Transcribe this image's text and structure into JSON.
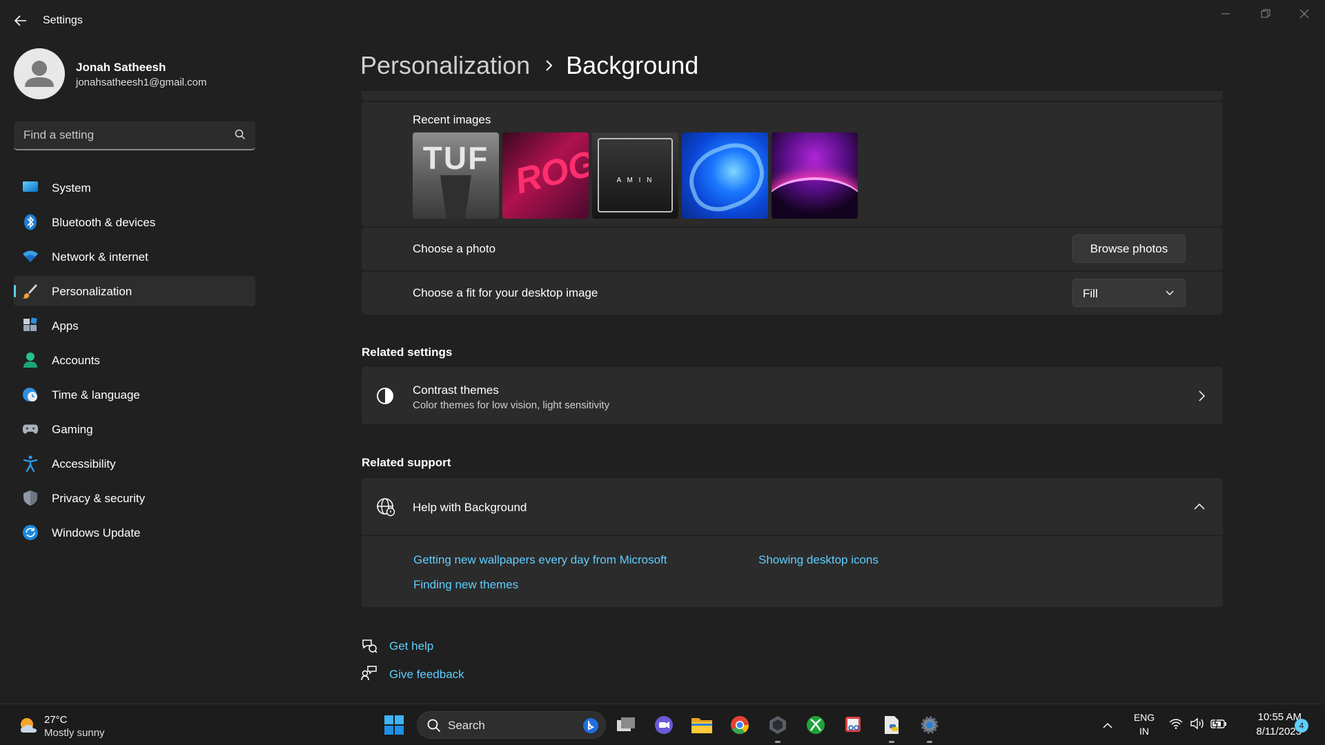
{
  "window": {
    "title": "Settings"
  },
  "user": {
    "name": "Jonah Satheesh",
    "email": "jonahsatheesh1@gmail.com"
  },
  "search": {
    "placeholder": "Find a setting"
  },
  "nav": {
    "items": [
      {
        "label": "System",
        "icon": "monitor-icon"
      },
      {
        "label": "Bluetooth & devices",
        "icon": "bluetooth-icon"
      },
      {
        "label": "Network & internet",
        "icon": "wifi-icon"
      },
      {
        "label": "Personalization",
        "icon": "brush-icon",
        "selected": true
      },
      {
        "label": "Apps",
        "icon": "apps-icon"
      },
      {
        "label": "Accounts",
        "icon": "person-icon"
      },
      {
        "label": "Time & language",
        "icon": "globe-clock-icon"
      },
      {
        "label": "Gaming",
        "icon": "gamepad-icon"
      },
      {
        "label": "Accessibility",
        "icon": "accessibility-icon"
      },
      {
        "label": "Privacy & security",
        "icon": "shield-icon"
      },
      {
        "label": "Windows Update",
        "icon": "update-icon"
      }
    ]
  },
  "breadcrumb": {
    "parent": "Personalization",
    "current": "Background"
  },
  "background": {
    "recent_label": "Recent images",
    "recent_images": [
      {
        "name": "tuf-wallpaper",
        "overlay_text": "TUF"
      },
      {
        "name": "rog-wallpaper",
        "overlay_text": "ROG"
      },
      {
        "name": "tuf-gaming-wallpaper",
        "overlay_text": "A M I N"
      },
      {
        "name": "windows-bloom-wallpaper",
        "overlay_text": ""
      },
      {
        "name": "purple-glow-wallpaper",
        "overlay_text": ""
      }
    ],
    "choose_photo_label": "Choose a photo",
    "browse_button": "Browse photos",
    "fit_label": "Choose a fit for your desktop image",
    "fit_value": "Fill"
  },
  "related_settings": {
    "title": "Related settings",
    "contrast_title": "Contrast themes",
    "contrast_desc": "Color themes for low vision, light sensitivity"
  },
  "related_support": {
    "title": "Related support",
    "help_title": "Help with Background",
    "links": [
      "Getting new wallpapers every day from Microsoft",
      "Showing desktop icons",
      "Finding new themes"
    ]
  },
  "footer": {
    "get_help": "Get help",
    "give_feedback": "Give feedback"
  },
  "taskbar": {
    "weather_temp": "27°C",
    "weather_desc": "Mostly sunny",
    "search_label": "Search",
    "lang_line1": "ENG",
    "lang_line2": "IN",
    "time": "10:55 AM",
    "date": "8/11/2023",
    "notification_count": "4"
  },
  "colors": {
    "accent": "#60cdff",
    "background": "#202020",
    "card": "#2b2b2b"
  }
}
